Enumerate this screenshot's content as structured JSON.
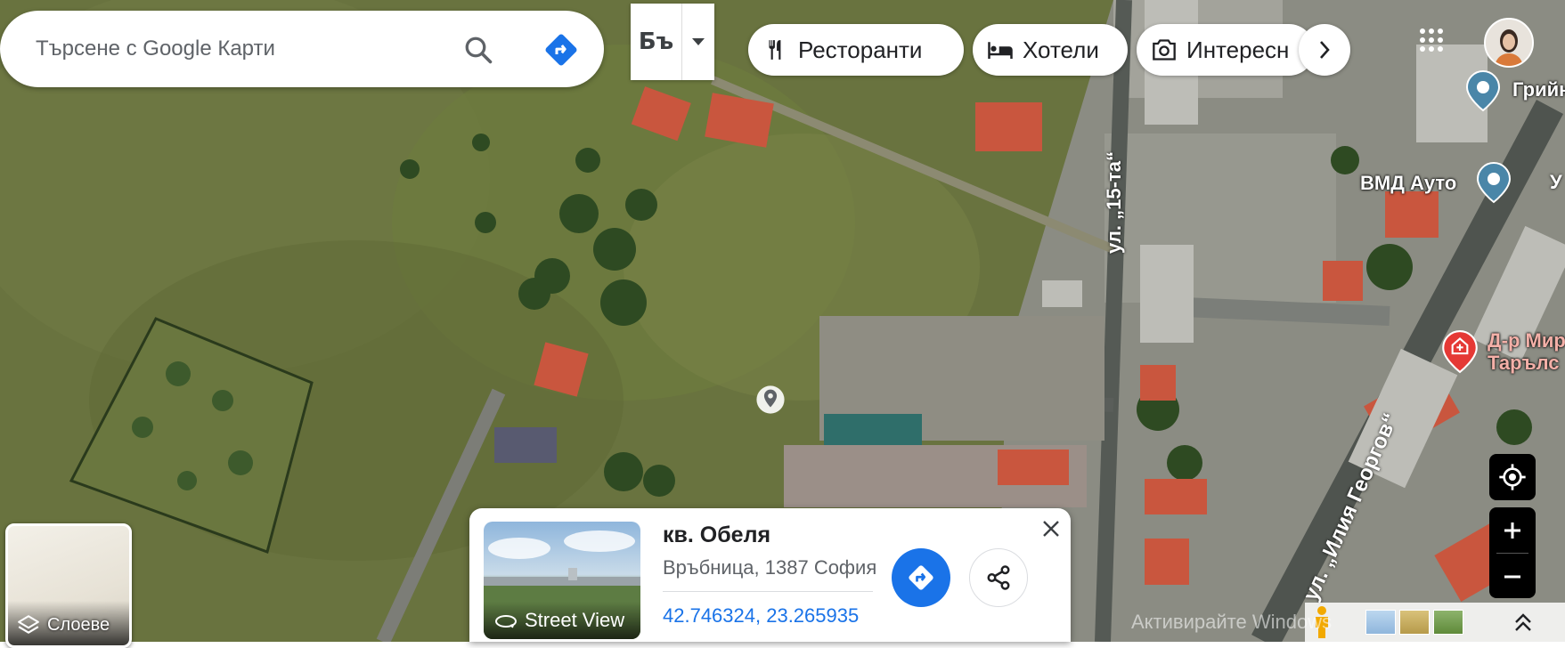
{
  "search": {
    "placeholder": "Търсене с Google Карти"
  },
  "map_type": {
    "label": "Бъ"
  },
  "chips": [
    {
      "label": "Ресторанти",
      "icon": "restaurant-icon"
    },
    {
      "label": "Хотели",
      "icon": "hotel-icon"
    },
    {
      "label": "Интересн",
      "icon": "camera-icon"
    }
  ],
  "places": [
    {
      "label": "Грийн"
    },
    {
      "label": "ВМД Ауто"
    },
    {
      "label": "Д-р Мир"
    },
    {
      "label": "Тарълс"
    }
  ],
  "streets": [
    {
      "label": "ул. „15-та“"
    },
    {
      "label": "ул. „Илия Георгов“"
    },
    {
      "label": "У"
    }
  ],
  "layers": {
    "label": "Слоеве"
  },
  "card": {
    "title": "кв. Обеля",
    "subtitle": "Връбница, 1387 София",
    "coordinates": "42.746324, 23.265935",
    "street_view": "Street View"
  },
  "watermark": "Активирайте Windows",
  "colors": {
    "accent": "#1a73e8",
    "place_pin": "#4a86a8",
    "red_pin": "#e53935"
  }
}
